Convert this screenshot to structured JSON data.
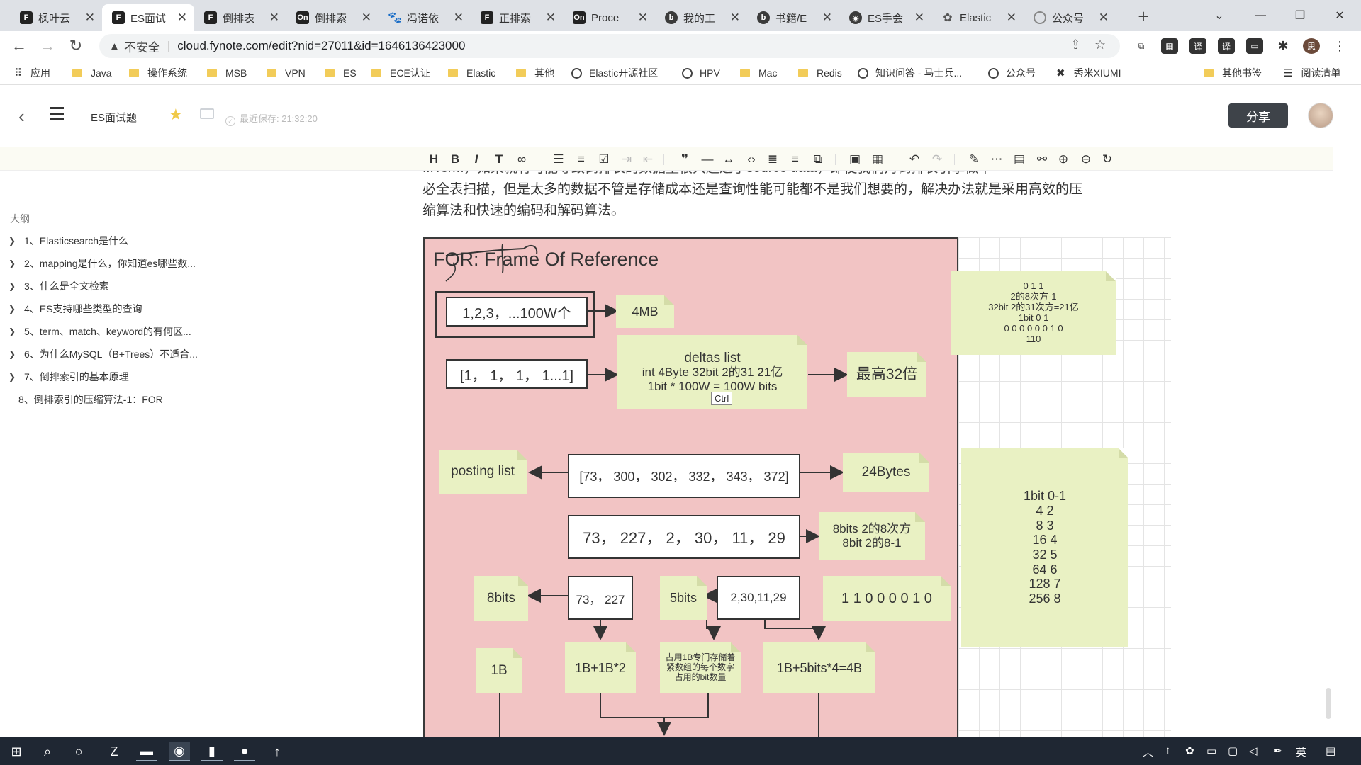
{
  "browser": {
    "tabs": [
      {
        "label": "枫叶云",
        "favicon": "F"
      },
      {
        "label": "ES面试",
        "favicon": "F",
        "active": true
      },
      {
        "label": "倒排表",
        "favicon": "F"
      },
      {
        "label": "倒排索",
        "favicon": "On"
      },
      {
        "label": "冯诺依",
        "favicon": "paw"
      },
      {
        "label": "正排索",
        "favicon": "F"
      },
      {
        "label": "Proce",
        "favicon": "On"
      },
      {
        "label": "我的工",
        "favicon": "b"
      },
      {
        "label": "书籍/E",
        "favicon": "b"
      },
      {
        "label": "ES手会",
        "favicon": "globe"
      },
      {
        "label": "Elastic",
        "favicon": "el"
      },
      {
        "label": "公众号",
        "favicon": "ring"
      }
    ],
    "new_tab": "+",
    "address": {
      "warning": "不安全",
      "url": "cloud.fynote.com/edit?nid=27011&id=1646136423000"
    },
    "bookmarks": [
      "应用",
      "Java",
      "操作系统",
      "MSB",
      "VPN",
      "ES",
      "ECE认证",
      "Elastic",
      "其他",
      "Elastic开源社区",
      "HPV",
      "Mac",
      "Redis",
      "知识问答 - 马士兵...",
      "公众号",
      "秀米XIUMI",
      "其他书签",
      "阅读清单"
    ]
  },
  "app": {
    "doc_title": "ES面试题",
    "last_saved": "最近保存: 21:32:20",
    "share_label": "分享"
  },
  "outline": {
    "title": "大纲",
    "items": [
      {
        "label": "1、Elasticsearch是什么",
        "expandable": true
      },
      {
        "label": "2、mapping是什么，你知道es哪些数...",
        "expandable": true
      },
      {
        "label": "3、什么是全文检索",
        "expandable": true
      },
      {
        "label": "4、ES支持哪些类型的查询",
        "expandable": true
      },
      {
        "label": "5、term、match、keyword的有何区...",
        "expandable": true
      },
      {
        "label": "6、为什么MySQL（B+Trees）不适合...",
        "expandable": true
      },
      {
        "label": "7、倒排索引的基本原理",
        "expandable": true
      },
      {
        "label": "8、倒排索引的压缩算法-1：FOR",
        "expandable": false
      }
    ]
  },
  "content": {
    "paragraph": {
      "partial_line": "...Term，如果就有可能导致倒排表的数据量很大超过了source data，即使我们对倒排表引擎做不",
      "line1": "必全表扫描，但是太多的数据不管是存储成本还是查询性能可能都不是我们想要的，解决办法就是采用高效的压",
      "line2": "缩算法和快速的编码和解码算法。"
    },
    "diagram": {
      "title": "FOR: Frame Of Reference",
      "box_raw": "1,2,3，...100W个",
      "note_4mb": "4MB",
      "box_ones": "[1，  1，  1，  1...1]",
      "deltas": {
        "title": "deltas list",
        "line1": "int 4Byte 32bit  2的31 21亿",
        "line2": "1bit * 100W = 100W bits"
      },
      "ctrl_tip": "Ctrl",
      "note_32x": "最高32倍",
      "note_bits_lines": [
        "0 1 1",
        "2的8次方-1",
        "32bit 2的31次方=21亿",
        "1bit 0 1",
        "0 0 0 0 0 0 1 0",
        "110"
      ],
      "note_posting": "posting list",
      "box_posting": "[73，  300，  302，  332，  343，  372]",
      "note_24bytes": "24Bytes",
      "box_deltas": "73，  227，  2，  30，  11，  29",
      "note_8bits_lines": [
        "8bits 2的8次方",
        "8bit  2的8-1"
      ],
      "note_8bits": "8bits",
      "box_73": "73，  227",
      "note_5bits": "5bits",
      "box_small": "2,30,11,29",
      "note_binary": "1 1 0 0 0 0 1 0",
      "note_table_lines": [
        "1bit  0-1",
        "4 2",
        "8  3",
        "16 4",
        "32 5",
        "64 6",
        "128 7",
        "256 8"
      ],
      "note_1b": "1B",
      "note_1b2": "1B+1B*2",
      "note_header_lines": [
        "占用1B专门存储着",
        "紧数组的每个数字",
        "占用的bit数量"
      ],
      "note_1b5": "1B+5bits*4=4B"
    }
  },
  "taskbar": {
    "tray_lang": "英"
  },
  "colors": {
    "board": "#f2c4c4",
    "note": "#e9f1c3",
    "share": "#3e4349",
    "star": "#f0c948"
  }
}
